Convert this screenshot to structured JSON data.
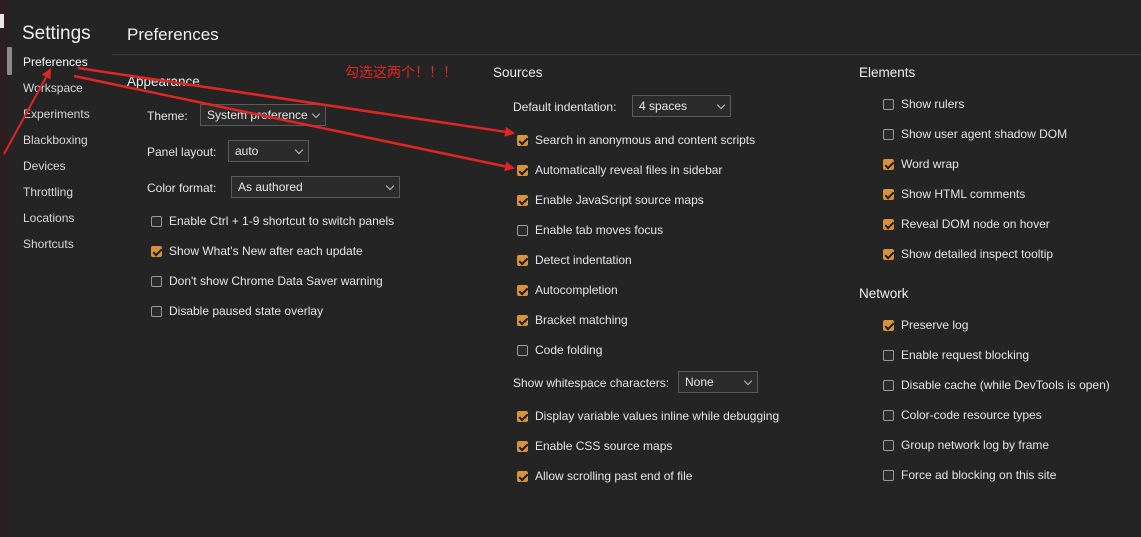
{
  "sidebar": {
    "title": "Settings",
    "items": [
      "Preferences",
      "Workspace",
      "Experiments",
      "Blackboxing",
      "Devices",
      "Throttling",
      "Locations",
      "Shortcuts"
    ]
  },
  "main": {
    "title": "Preferences"
  },
  "annotation": "勾选这两个！！！",
  "appearance": {
    "title": "Appearance",
    "theme_label": "Theme:",
    "theme_value": "System preference",
    "panel_label": "Panel layout:",
    "panel_value": "auto",
    "color_label": "Color format:",
    "color_value": "As authored",
    "checkboxes": [
      {
        "label": "Enable Ctrl + 1-9 shortcut to switch panels",
        "checked": false
      },
      {
        "label": "Show What's New after each update",
        "checked": true
      },
      {
        "label": "Don't show Chrome Data Saver warning",
        "checked": false
      },
      {
        "label": "Disable paused state overlay",
        "checked": false
      }
    ]
  },
  "sources": {
    "title": "Sources",
    "indent_label": "Default indentation:",
    "indent_value": "4 spaces",
    "checkboxes": [
      {
        "label": "Search in anonymous and content scripts",
        "checked": true
      },
      {
        "label": "Automatically reveal files in sidebar",
        "checked": true
      },
      {
        "label": "Enable JavaScript source maps",
        "checked": true
      },
      {
        "label": "Enable tab moves focus",
        "checked": false
      },
      {
        "label": "Detect indentation",
        "checked": true
      },
      {
        "label": "Autocompletion",
        "checked": true
      },
      {
        "label": "Bracket matching",
        "checked": true
      },
      {
        "label": "Code folding",
        "checked": false
      }
    ],
    "whitespace_label": "Show whitespace characters:",
    "whitespace_value": "None",
    "checkboxes2": [
      {
        "label": "Display variable values inline while debugging",
        "checked": true
      },
      {
        "label": "Enable CSS source maps",
        "checked": true
      },
      {
        "label": "Allow scrolling past end of file",
        "checked": true
      }
    ]
  },
  "elements": {
    "title": "Elements",
    "checkboxes": [
      {
        "label": "Show rulers",
        "checked": false
      },
      {
        "label": "Show user agent shadow DOM",
        "checked": false
      },
      {
        "label": "Word wrap",
        "checked": true
      },
      {
        "label": "Show HTML comments",
        "checked": true
      },
      {
        "label": "Reveal DOM node on hover",
        "checked": true
      },
      {
        "label": "Show detailed inspect tooltip",
        "checked": true
      }
    ]
  },
  "network": {
    "title": "Network",
    "checkboxes": [
      {
        "label": "Preserve log",
        "checked": true
      },
      {
        "label": "Enable request blocking",
        "checked": false
      },
      {
        "label": "Disable cache (while DevTools is open)",
        "checked": false
      },
      {
        "label": "Color-code resource types",
        "checked": false
      },
      {
        "label": "Group network log by frame",
        "checked": false
      },
      {
        "label": "Force ad blocking on this site",
        "checked": false
      }
    ]
  },
  "colors": {
    "accent": "#d8923a",
    "annotation": "#e02525",
    "background": "#242424"
  }
}
